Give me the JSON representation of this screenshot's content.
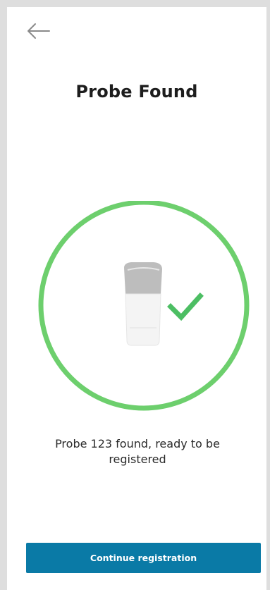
{
  "header": {
    "back_icon": "arrow-left-icon",
    "title": "Probe Found"
  },
  "status": {
    "ring_color": "#6dcf6d",
    "check_color": "#4cbe63",
    "probe_icon": "probe-icon",
    "check_icon": "check-icon",
    "message": "Probe 123 found, ready to be registered"
  },
  "actions": {
    "continue_label": "Continue registration",
    "continue_color": "#0a7aa6"
  }
}
